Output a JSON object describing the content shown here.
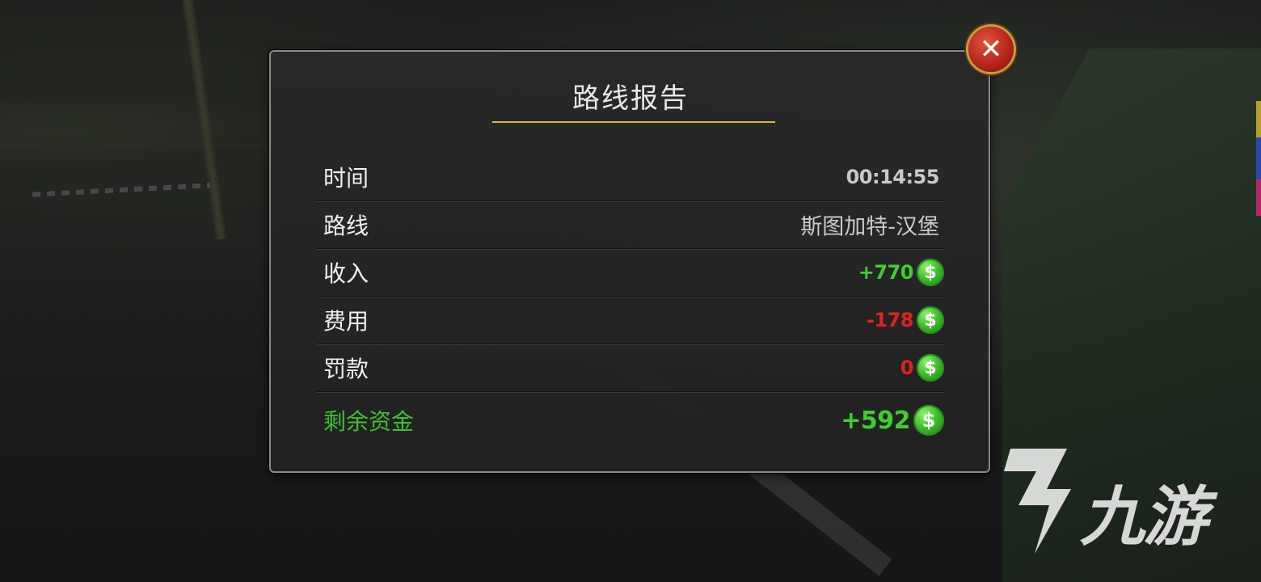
{
  "report": {
    "title": "路线报告",
    "rows": [
      {
        "label": "时间",
        "value": "00:14:55"
      },
      {
        "label": "路线",
        "value": "斯图加特-汉堡"
      },
      {
        "label": "收入",
        "value": "+770"
      },
      {
        "label": "费用",
        "value": "-178"
      },
      {
        "label": "罚款",
        "value": "0"
      }
    ],
    "total": {
      "label": "剩余资金",
      "value": "+592"
    },
    "currency_symbol": "$"
  },
  "close_button": {
    "symbol": "✕"
  },
  "watermark": {
    "text": "九游"
  },
  "colors": {
    "positive": "#3fce2f",
    "negative": "#e0231a",
    "accent_line": "#d9b347",
    "close_red": "#b8261a"
  },
  "icons": [
    "close-icon",
    "dollar-coin-icon",
    "watermark-logo-icon"
  ]
}
